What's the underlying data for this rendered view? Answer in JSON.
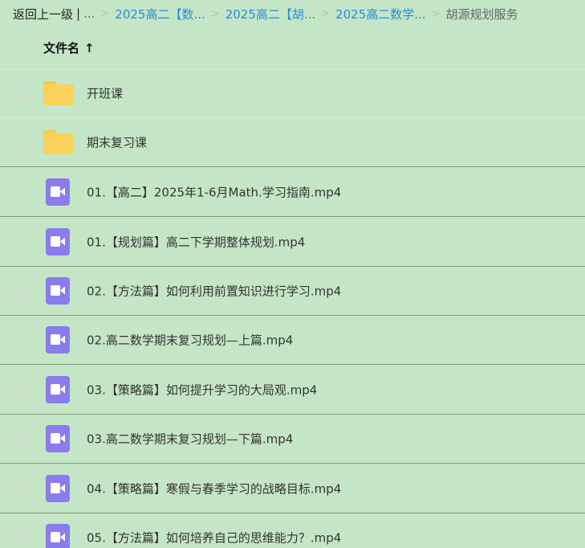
{
  "breadcrumb": {
    "back_label": "返回上一级",
    "separator": "|",
    "ellipsis": "...",
    "links": [
      "2025高二【数...",
      "2025高二【胡...",
      "2025高二数学..."
    ],
    "current": "胡源规划服务"
  },
  "header": {
    "title": "文件名",
    "sort_symbol": "↑"
  },
  "files": [
    {
      "name": "开班课",
      "type": "folder"
    },
    {
      "name": "期末复习课",
      "type": "folder"
    },
    {
      "name": "01.【高二】2025年1-6月Math.学习指南.mp4",
      "type": "video"
    },
    {
      "name": "01.【规划篇】高二下学期整体规划.mp4",
      "type": "video"
    },
    {
      "name": "02.【方法篇】如何利用前置知识进行学习.mp4",
      "type": "video"
    },
    {
      "name": "02.高二数学期末复习规划—上篇.mp4",
      "type": "video"
    },
    {
      "name": "03.【策略篇】如何提升学习的大局观.mp4",
      "type": "video"
    },
    {
      "name": "03.高二数学期末复习规划—下篇.mp4",
      "type": "video"
    },
    {
      "name": "04.【策略篇】寒假与春季学习的战略目标.mp4",
      "type": "video"
    },
    {
      "name": "05.【方法篇】如何培养自己的思维能力？.mp4",
      "type": "video"
    }
  ],
  "colors": {
    "background": "#c4e6c6",
    "link": "#2a8ad8",
    "folder": "#fad25a",
    "video": "#8a7cec"
  }
}
